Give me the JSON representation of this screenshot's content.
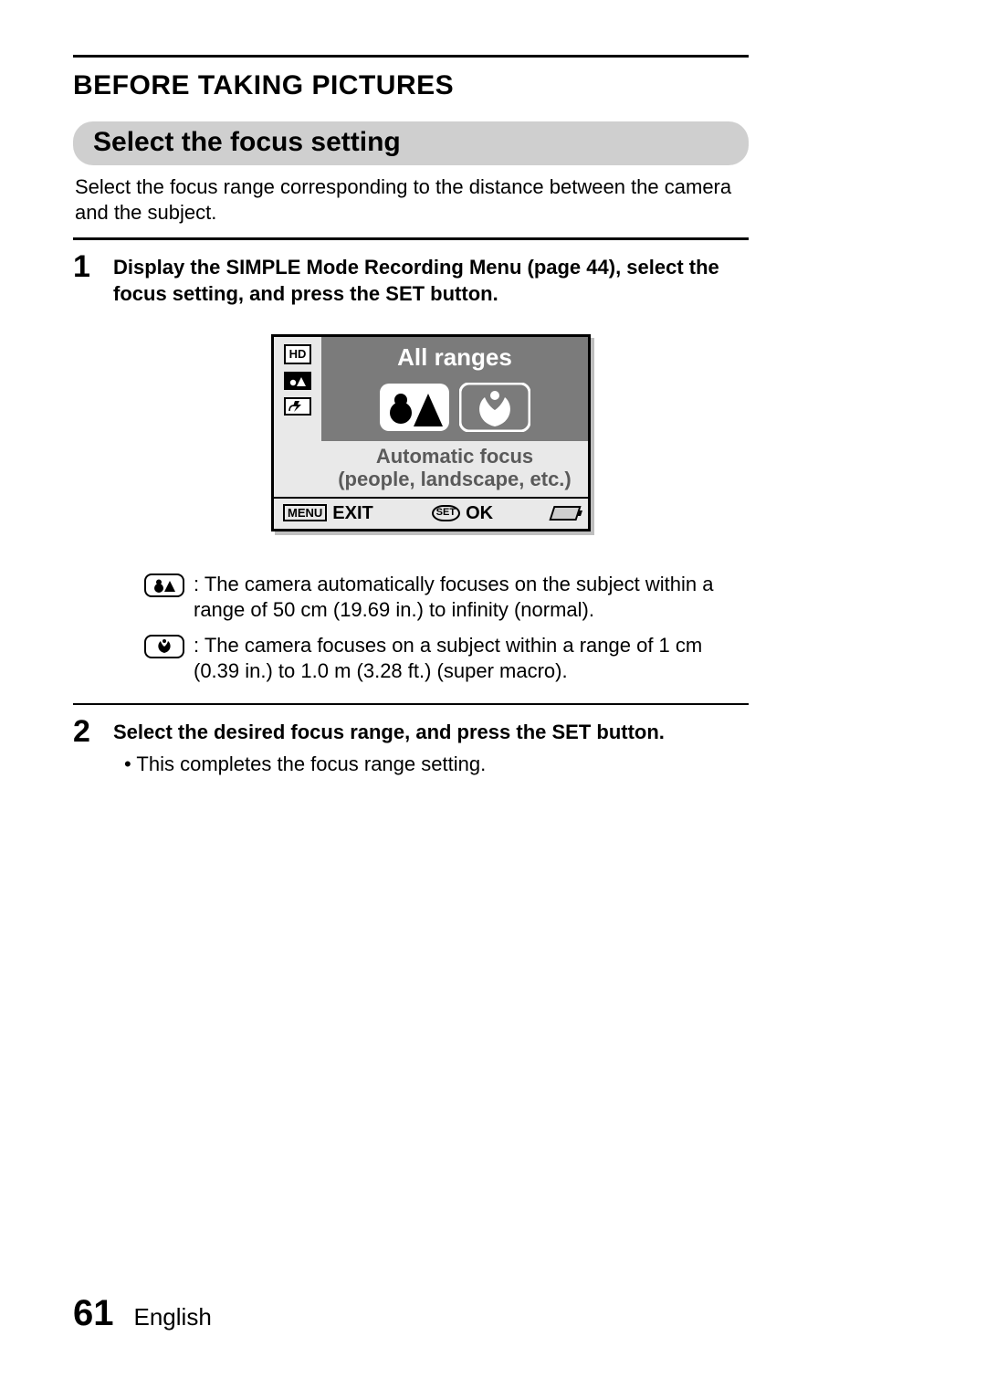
{
  "header": {
    "page_title": "BEFORE TAKING PICTURES",
    "subheader": "Select the focus setting"
  },
  "intro": "Select the focus range corresponding to the distance between the camera and the subject.",
  "steps": [
    {
      "num": "1",
      "head": "Display the SIMPLE Mode Recording Menu (page 44), select the focus setting, and press the SET button."
    },
    {
      "num": "2",
      "head": "Select the desired focus range, and press the SET button.",
      "sub": "This completes the focus range setting."
    }
  ],
  "camera_screen": {
    "title": "All ranges",
    "desc_line1": "Automatic focus",
    "desc_line2": "(people, landscape, etc.)",
    "side_hd": "HD",
    "menu_label": "MENU",
    "exit_label": "EXIT",
    "set_label": "SET",
    "ok_label": "OK"
  },
  "icon_lines": [
    ": The camera automatically focuses on the subject within a range of 50 cm (19.69 in.) to infinity (normal).",
    ": The camera focuses on a subject within a range of 1 cm (0.39 in.) to 1.0 m (3.28 ft.) (super macro)."
  ],
  "footer": {
    "page_number": "61",
    "language": "English"
  }
}
